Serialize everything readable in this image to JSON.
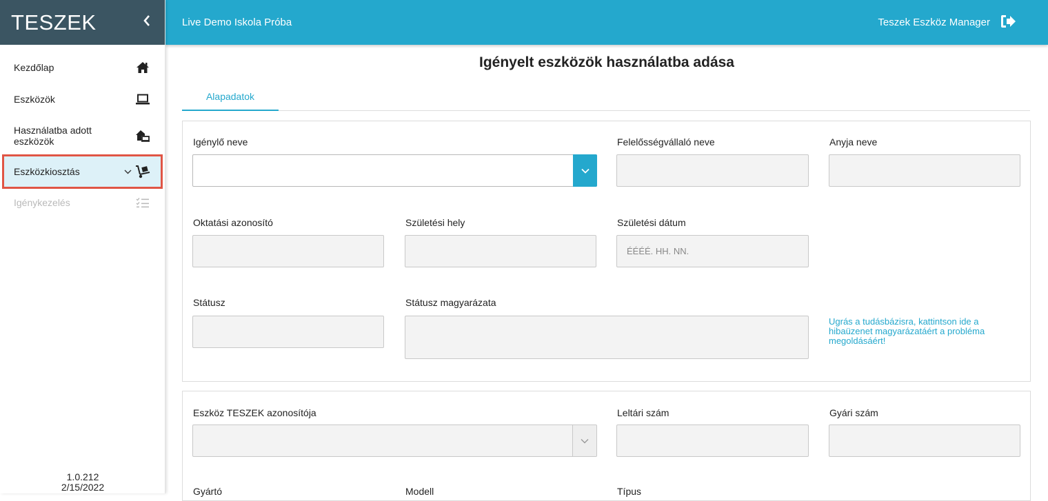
{
  "sidebar": {
    "brand": "TESZEK",
    "collapse_icon": "chevron-left-icon",
    "items": [
      {
        "label": "Kezdőlap",
        "icon": "home-icon"
      },
      {
        "label": "Eszközök",
        "icon": "laptop-icon"
      },
      {
        "label": "Használatba adott eszközök",
        "icon": "house-device-icon"
      },
      {
        "label": "Eszközkiosztás",
        "icon": "hand-truck-icon",
        "active": true
      },
      {
        "label": "Igénykezelés",
        "icon": "checklist-icon",
        "disabled": true
      }
    ],
    "version": "1.0.212",
    "date": "2/15/2022"
  },
  "header": {
    "school": "Live Demo Iskola Próba",
    "app_name": "Teszek Eszköz Manager",
    "logout_icon": "sign-out-icon"
  },
  "main": {
    "title": "Igényelt eszközök használatba adása",
    "tabs": [
      {
        "label": "Alapadatok",
        "active": true
      }
    ],
    "card1": {
      "igenylo_neve": "Igénylő neve",
      "felelossegvallalo_neve": "Felelősségvállaló neve",
      "anyja_neve": "Anyja neve",
      "oktatasi_azonosito": "Oktatási azonosító",
      "szuletesi_hely": "Születési hely",
      "szuletesi_datum": "Születési dátum",
      "date_placeholder": "ÉÉÉÉ. HH. NN.",
      "statusz": "Státusz",
      "statusz_magyarazata": "Státusz magyarázata",
      "help_link": "Ugrás a tudásbázisra, kattintson ide a hibaüzenet magyarázatáért a probléma megoldásáért!"
    },
    "card2": {
      "eszkoz_azonosito": "Eszköz TESZEK azonosítója",
      "leltari_szam": "Leltári szám",
      "gyari_szam": "Gyári szám",
      "gyarto": "Gyártó",
      "modell": "Modell",
      "tipus": "Típus"
    }
  },
  "colors": {
    "accent": "#24a8cd",
    "sidebar_brand_bg": "#3b5562",
    "active_bg": "#ddf1f8",
    "highlight_border": "#e05545"
  }
}
